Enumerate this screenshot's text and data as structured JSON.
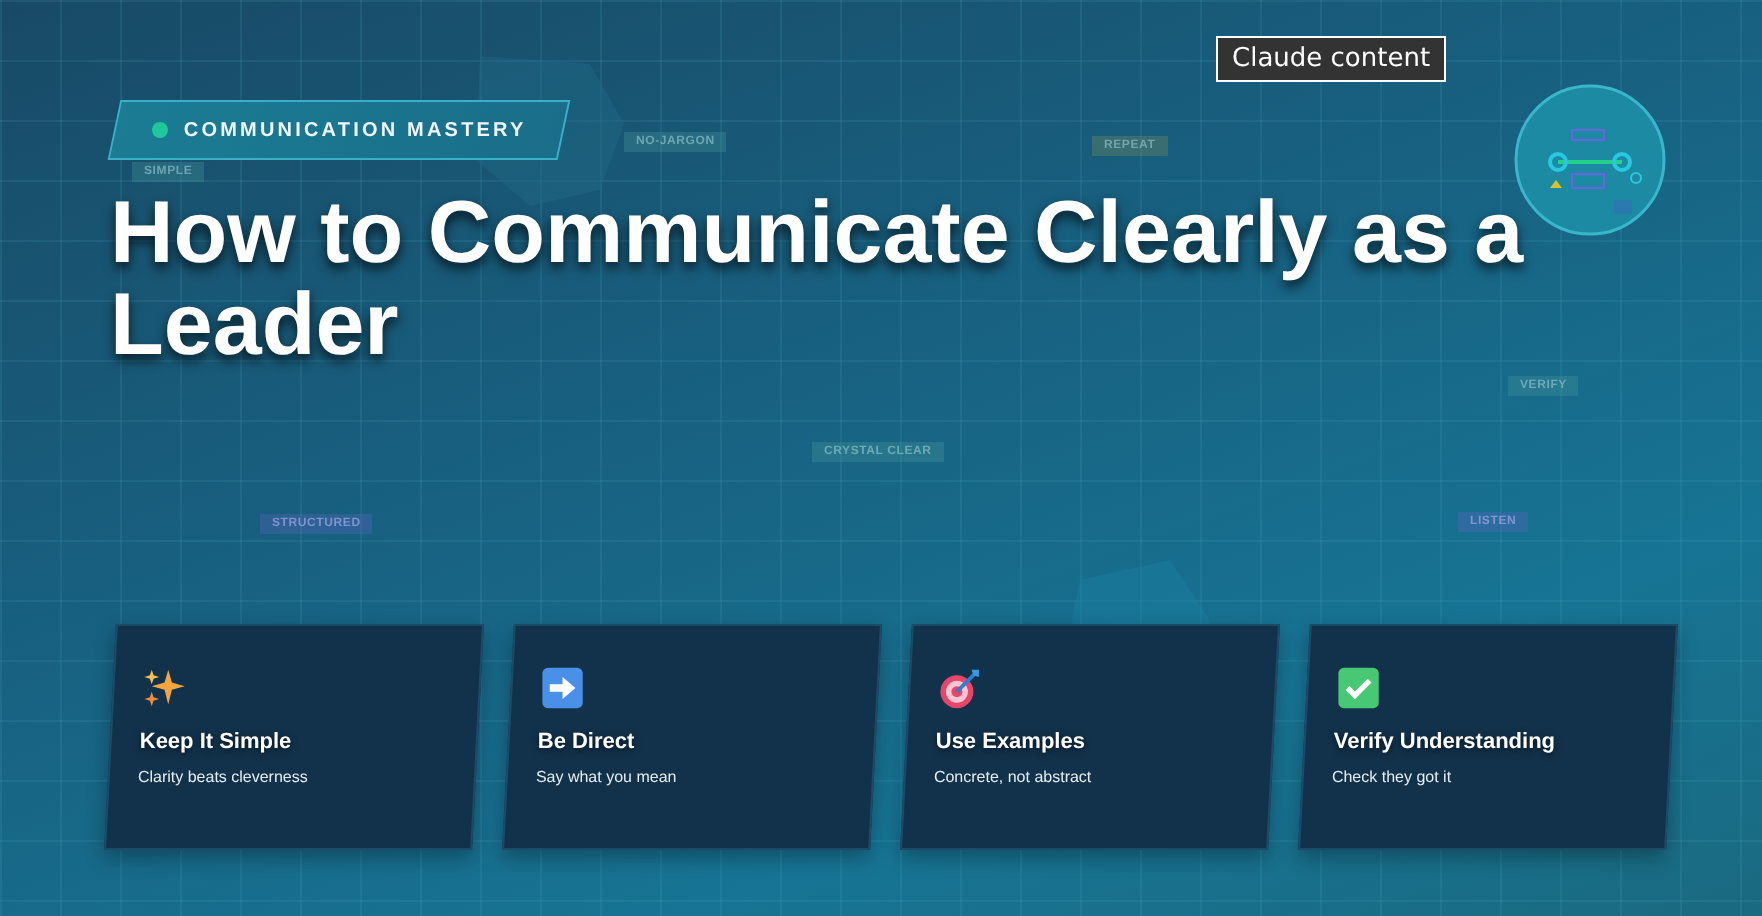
{
  "tooltip": "Claude content",
  "badge": {
    "label": "COMMUNICATION MASTERY"
  },
  "title": "How to Communicate Clearly as a Leader",
  "tags": [
    {
      "label": "SIMPLE"
    },
    {
      "label": "NO-JARGON"
    },
    {
      "label": "REPEAT"
    },
    {
      "label": "VERIFY"
    },
    {
      "label": "CRYSTAL CLEAR"
    },
    {
      "label": "STRUCTURED"
    },
    {
      "label": "LISTEN"
    }
  ],
  "cards": [
    {
      "title": "Keep It Simple",
      "text": "Clarity beats cleverness"
    },
    {
      "title": "Be Direct",
      "text": "Say what you mean"
    },
    {
      "title": "Use Examples",
      "text": "Concrete, not abstract"
    },
    {
      "title": "Verify Understanding",
      "text": "Check they got it"
    }
  ]
}
